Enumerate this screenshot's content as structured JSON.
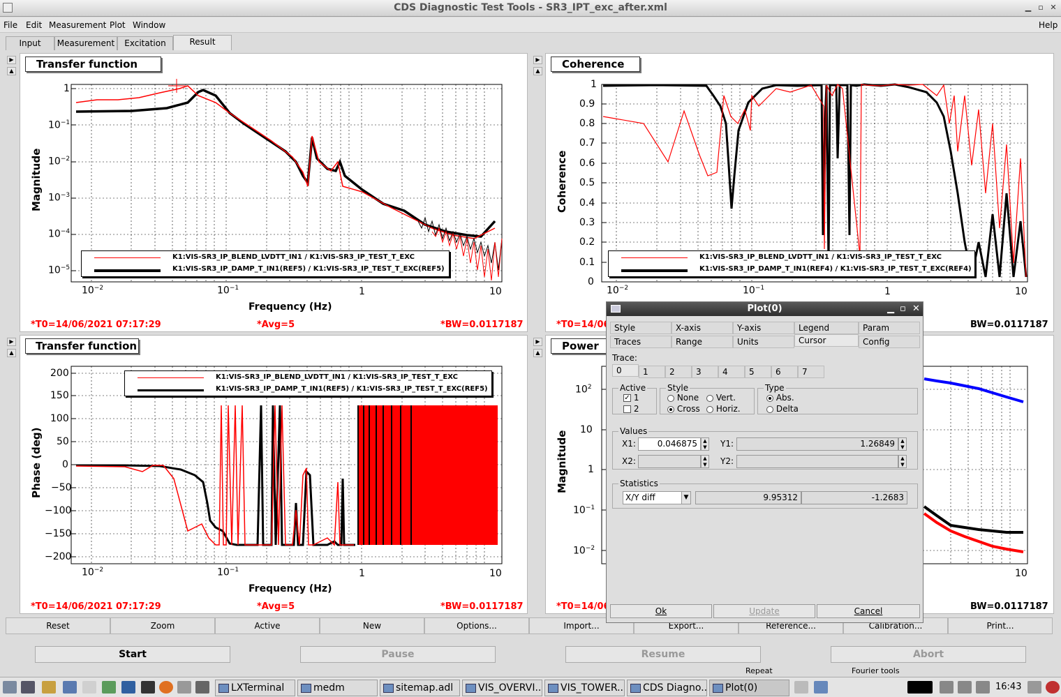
{
  "window": {
    "title": "CDS Diagnostic Test Tools - SR3_IPT_exc_after.xml"
  },
  "menu": {
    "file": "File",
    "edit": "Edit",
    "measurement": "Measurement",
    "plot": "Plot",
    "window": "Window",
    "help": "Help"
  },
  "tabs": [
    "Input",
    "Measurement",
    "Excitation",
    "Result"
  ],
  "panels": {
    "tl": {
      "title": "Transfer function",
      "ylabel": "Magnitude",
      "xlabel": "Frequency (Hz)",
      "t0": "*T0=14/06/2021 07:17:29",
      "avg": "*Avg=5",
      "bw": "*BW=0.0117187",
      "yticks": [
        "1",
        "10",
        "10",
        "10",
        "10",
        "10"
      ],
      "yexp": [
        "",
        "−1",
        "−2",
        "−3",
        "−4",
        "−5"
      ],
      "xticks": [
        "10",
        "10",
        "1",
        "10"
      ],
      "xexp": [
        "−2",
        "−1",
        "",
        ""
      ],
      "legend": [
        "K1:VIS-SR3_IP_BLEND_LVDTT_IN1 / K1:VIS-SR3_IP_TEST_T_EXC",
        "K1:VIS-SR3_IP_DAMP_T_IN1(REF5) / K1:VIS-SR3_IP_TEST_T_EXC(REF5)"
      ]
    },
    "tr": {
      "title": "Coherence",
      "ylabel": "Coherence",
      "t0": "*T0=14/06",
      "bw": "BW=0.0117187",
      "yticks": [
        "1",
        "0.9",
        "0.8",
        "0.7",
        "0.6",
        "0.5",
        "0.4",
        "0.3",
        "0.2",
        "0.1",
        "0"
      ],
      "xticks": [
        "10",
        "10",
        "1",
        "10"
      ],
      "xexp": [
        "−2",
        "−1",
        "",
        ""
      ],
      "legend": [
        "K1:VIS-SR3_IP_BLEND_LVDTT_IN1 / K1:VIS-SR3_IP_TEST_T_EXC",
        "K1:VIS-SR3_IP_DAMP_T_IN1(REF4) / K1:VIS-SR3_IP_TEST_T_EXC(REF4)"
      ]
    },
    "bl": {
      "title": "Transfer function",
      "ylabel": "Phase (deg)",
      "xlabel": "Frequency (Hz)",
      "t0": "*T0=14/06/2021 07:17:29",
      "avg": "*Avg=5",
      "bw": "*BW=0.0117187",
      "yticks": [
        "200",
        "150",
        "100",
        "50",
        "0",
        "−50",
        "−100",
        "−150",
        "−200"
      ],
      "xticks": [
        "10",
        "10",
        "1",
        "10"
      ],
      "xexp": [
        "−2",
        "−1",
        "",
        ""
      ],
      "legend": [
        "K1:VIS-SR3_IP_BLEND_LVDTT_IN1 / K1:VIS-SR3_IP_TEST_T_EXC",
        "K1:VIS-SR3_IP_DAMP_T_IN1(REF5) / K1:VIS-SR3_IP_TEST_T_EXC(REF5)"
      ]
    },
    "br": {
      "title": "Power",
      "ylabel": "Magnitude",
      "t0": "*T0=14/06",
      "bw": "BW=0.0117187",
      "yticks": [
        "10",
        "10",
        "1",
        "10",
        "10"
      ],
      "yexp": [
        "2",
        "",
        "",
        "−1",
        "−2"
      ],
      "xticks": [
        "10"
      ]
    }
  },
  "buttons": [
    "Reset",
    "Zoom",
    "Active",
    "New",
    "Options...",
    "Import...",
    "Export...",
    "Reference...",
    "Calibration...",
    "Print..."
  ],
  "controls": {
    "start": "Start",
    "pause": "Pause",
    "resume": "Resume",
    "abort": "Abort"
  },
  "status": {
    "repeat": "Repeat",
    "fourier": "Fourier tools"
  },
  "dialog": {
    "title": "Plot(0)",
    "tabs_row1": [
      "Style",
      "X-axis",
      "Y-axis",
      "Legend",
      "Param"
    ],
    "tabs_row2": [
      "Traces",
      "Range",
      "Units",
      "Cursor",
      "Config"
    ],
    "trace_label": "Trace:",
    "trace_tabs": [
      "0",
      "1",
      "2",
      "3",
      "4",
      "5",
      "6",
      "7"
    ],
    "active": {
      "label": "Active",
      "items": [
        "1",
        "2"
      ]
    },
    "style": {
      "label": "Style",
      "none": "None",
      "vert": "Vert.",
      "cross": "Cross",
      "horiz": "Horiz."
    },
    "type": {
      "label": "Type",
      "abs": "Abs.",
      "delta": "Delta"
    },
    "values": {
      "label": "Values",
      "x1_label": "X1:",
      "x1": "0.046875",
      "y1_label": "Y1:",
      "y1": "1.26849",
      "x2_label": "X2:",
      "y2_label": "Y2:"
    },
    "statistics": {
      "label": "Statistics",
      "select": "X/Y diff",
      "v1": "9.95312",
      "v2": "-1.2683"
    },
    "ok": "Ok",
    "update": "Update",
    "cancel": "Cancel"
  },
  "taskbar": {
    "items": [
      "LXTerminal",
      "medm",
      "sitemap.adl",
      "VIS_OVERVI...",
      "VIS_TOWER...",
      "CDS Diagno...",
      "Plot(0)"
    ],
    "clock": "16:43"
  },
  "colors": {
    "trace_red": "#ff0000",
    "trace_black": "#000000",
    "trace_blue": "#0000ff"
  }
}
